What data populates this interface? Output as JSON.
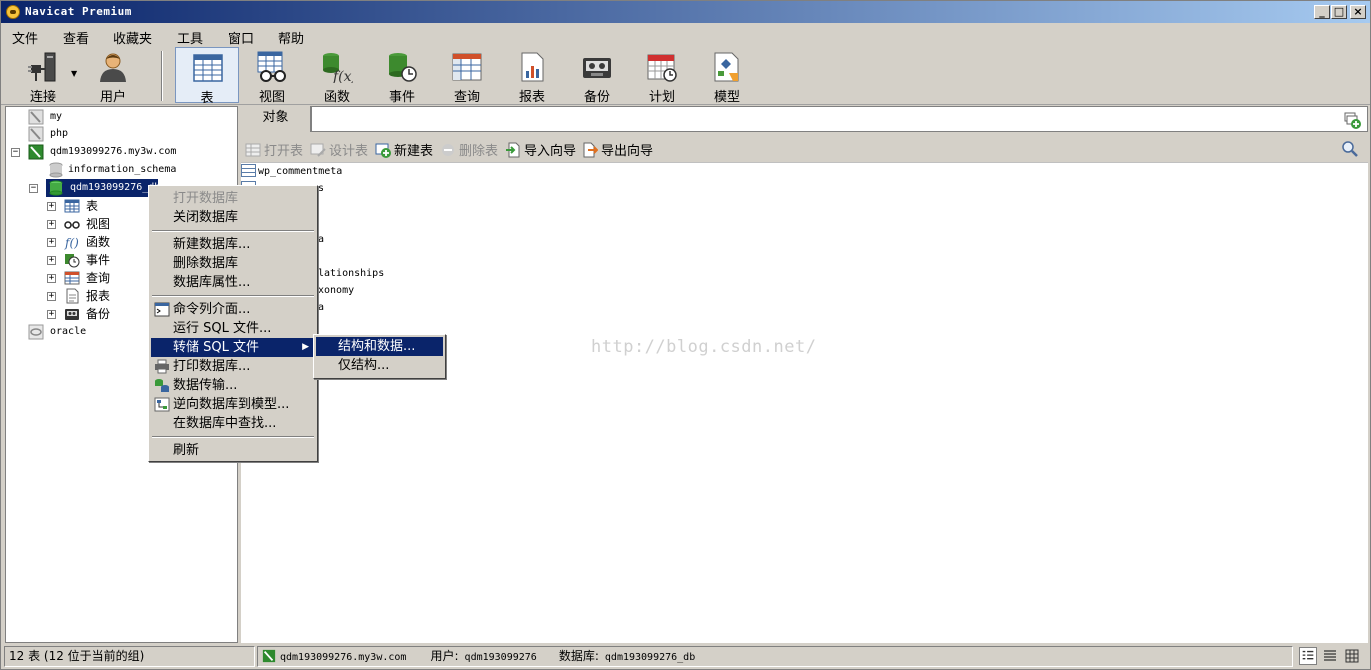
{
  "window": {
    "title": "Navicat Premium",
    "controls": [
      "_",
      "□",
      "×"
    ]
  },
  "menubar": [
    "文件",
    "查看",
    "收藏夹",
    "工具",
    "窗口",
    "帮助"
  ],
  "toolbar": {
    "items": [
      {
        "label": "连接",
        "icon": "connection-plug-icon"
      },
      {
        "label": "用户",
        "icon": "user-icon"
      },
      {
        "label": "表",
        "icon": "table-icon",
        "active": true
      },
      {
        "label": "视图",
        "icon": "view-glasses-icon"
      },
      {
        "label": "函数",
        "icon": "function-icon"
      },
      {
        "label": "事件",
        "icon": "event-clock-icon"
      },
      {
        "label": "查询",
        "icon": "query-icon"
      },
      {
        "label": "报表",
        "icon": "report-icon"
      },
      {
        "label": "备份",
        "icon": "backup-tape-icon"
      },
      {
        "label": "计划",
        "icon": "schedule-calendar-icon"
      },
      {
        "label": "模型",
        "icon": "model-icon"
      }
    ]
  },
  "tree": {
    "nodes": [
      {
        "label": "my",
        "type": "connection-mysql-closed"
      },
      {
        "label": "php",
        "type": "connection-mysql-closed"
      },
      {
        "label": "qdm193099276.my3w.com",
        "type": "connection-mysql-open"
      },
      {
        "label": "information_schema",
        "type": "database-closed"
      },
      {
        "label": "qdm193099276_db",
        "type": "database-open",
        "selected": true
      },
      {
        "label": "表",
        "type": "table-folder"
      },
      {
        "label": "视图",
        "type": "view-folder"
      },
      {
        "label": "函数",
        "type": "function-folder"
      },
      {
        "label": "事件",
        "type": "event-folder"
      },
      {
        "label": "查询",
        "type": "query-folder"
      },
      {
        "label": "报表",
        "type": "report-folder"
      },
      {
        "label": "备份",
        "type": "backup-folder"
      },
      {
        "label": "oracle",
        "type": "connection-oracle"
      }
    ]
  },
  "objects": {
    "tab_label": "对象",
    "tools": [
      {
        "label": "打开表",
        "enabled": false
      },
      {
        "label": "设计表",
        "enabled": false
      },
      {
        "label": "新建表",
        "enabled": true
      },
      {
        "label": "删除表",
        "enabled": false
      },
      {
        "label": "导入向导",
        "enabled": true
      },
      {
        "label": "导出向导",
        "enabled": true
      }
    ],
    "list": [
      "wp_commentmeta",
      "s",
      "",
      "",
      "a",
      "",
      "lationships",
      "xonomy",
      "a"
    ],
    "watermark": "http://blog.csdn.net/"
  },
  "context_menu": {
    "items": [
      {
        "label": "打开数据库",
        "enabled": false
      },
      {
        "label": "关闭数据库",
        "enabled": true
      },
      {
        "label": "新建数据库...",
        "enabled": true
      },
      {
        "label": "删除数据库",
        "enabled": true
      },
      {
        "label": "数据库属性...",
        "enabled": true
      },
      {
        "label": "命令列介面...",
        "enabled": true
      },
      {
        "label": "运行 SQL 文件...",
        "enabled": true
      },
      {
        "label": "转储 SQL 文件",
        "enabled": true,
        "highlighted": true
      },
      {
        "label": "打印数据库...",
        "enabled": true
      },
      {
        "label": "数据传输...",
        "enabled": true
      },
      {
        "label": "逆向数据库到模型...",
        "enabled": true
      },
      {
        "label": "在数据库中查找...",
        "enabled": true
      },
      {
        "label": "刷新",
        "enabled": true
      }
    ],
    "submenu": [
      {
        "label": "结构和数据...",
        "highlighted": true
      },
      {
        "label": "仅结构..."
      }
    ]
  },
  "statusbar": {
    "count": "12 表 (12 位于当前的组)",
    "connection": "qdm193099276.my3w.com",
    "user_label": "用户:",
    "user": "qdm193099276",
    "db_label": "数据库:",
    "database": "qdm193099276_db"
  }
}
